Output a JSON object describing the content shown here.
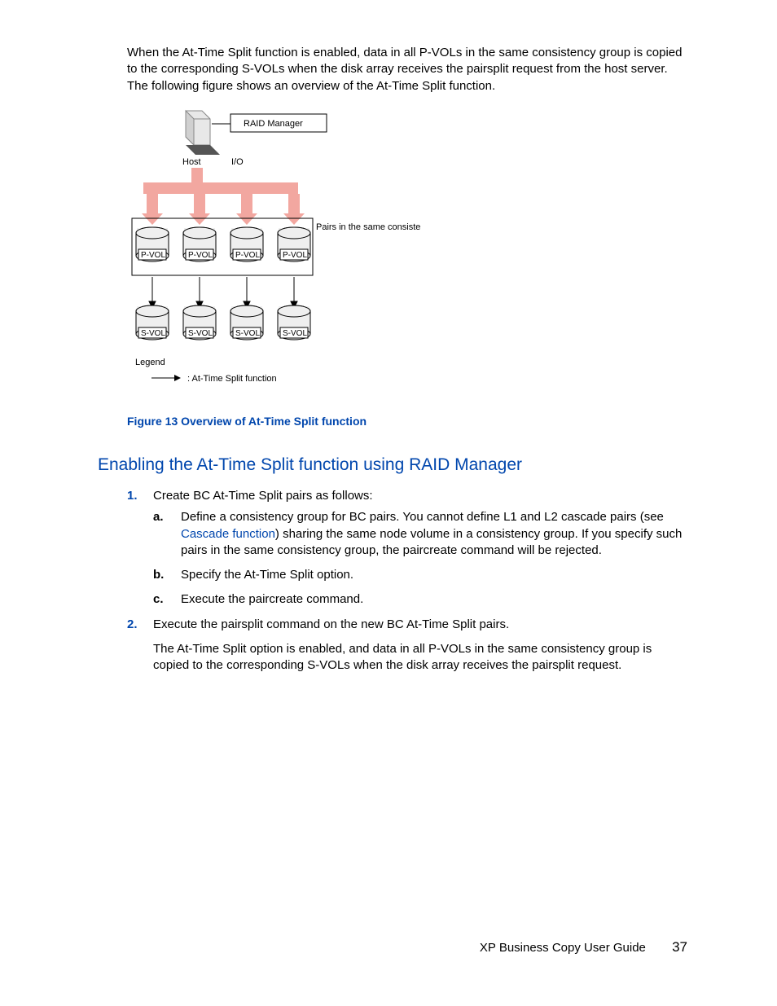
{
  "intro": "When the At-Time Split function is enabled, data in all P-VOLs in the same consistency group is copied to the corresponding S-VOLs when the disk array receives the pairsplit request from the host server. The following figure shows an overview of the At-Time Split function.",
  "diagram": {
    "raid_manager": "RAID Manager",
    "host": "Host",
    "io": "I/O",
    "pairs_note": "Pairs in the same consistency group",
    "pvol": "P-VOL",
    "svol": "S-VOL",
    "legend_title": "Legend",
    "legend_item": ": At-Time Split function"
  },
  "fig_caption": "Figure 13 Overview of At-Time Split function",
  "section_heading": "Enabling the At-Time Split function using RAID Manager",
  "steps": {
    "s1": {
      "marker": "1.",
      "text": "Create BC At-Time Split pairs as follows:",
      "a": {
        "marker": "a.",
        "pre": "Define a consistency group for BC pairs. You cannot define L1 and L2 cascade pairs (see ",
        "link": "Cascade function",
        "post": ") sharing the same node volume in a consistency group. If you specify such pairs in the same consistency group, the paircreate command will be rejected."
      },
      "b": {
        "marker": "b.",
        "text": "Specify the At-Time Split option."
      },
      "c": {
        "marker": "c.",
        "text": "Execute the paircreate command."
      }
    },
    "s2": {
      "marker": "2.",
      "text": "Execute the pairsplit command on the new BC At-Time Split pairs.",
      "after": "The At-Time Split option is enabled, and data in all P-VOLs in the same consistency group is copied to the corresponding S-VOLs when the disk array receives the pairsplit request."
    }
  },
  "footer": {
    "guide": "XP Business Copy User Guide",
    "pagenum": "37"
  }
}
